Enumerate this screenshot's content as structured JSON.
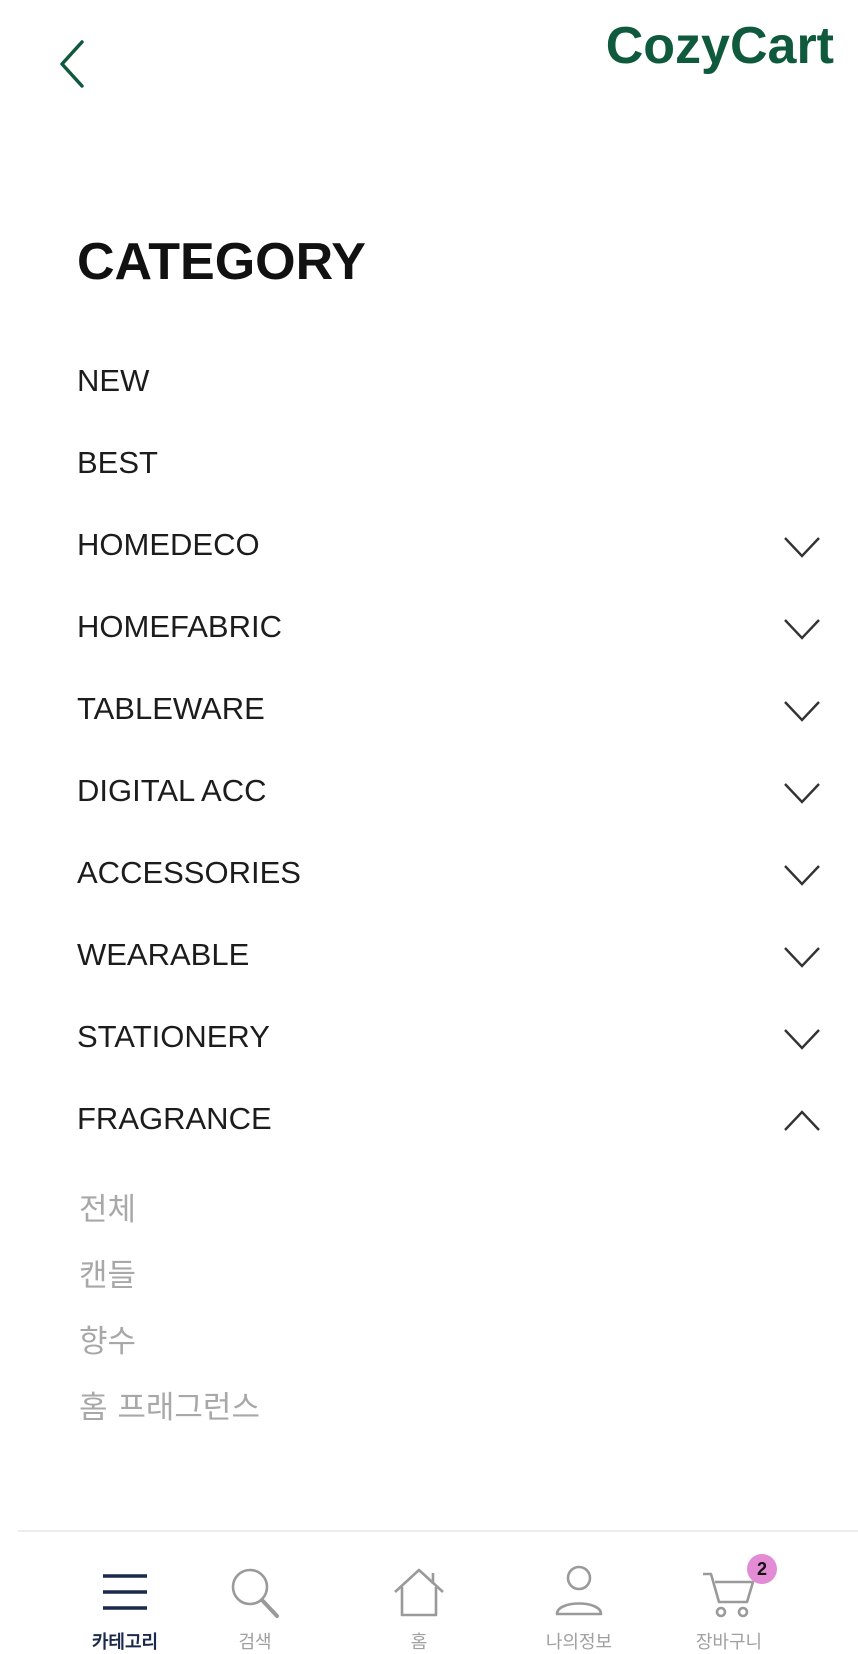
{
  "header": {
    "brand": "CozyCart",
    "brand_color": "#0f5a3c",
    "back_icon": "chevron-left-icon"
  },
  "page": {
    "title": "CATEGORY"
  },
  "categories": [
    {
      "label": "NEW",
      "expandable": false
    },
    {
      "label": "BEST",
      "expandable": false
    },
    {
      "label": "HOMEDECO",
      "expandable": true,
      "expanded": false
    },
    {
      "label": "HOMEFABRIC",
      "expandable": true,
      "expanded": false
    },
    {
      "label": "TABLEWARE",
      "expandable": true,
      "expanded": false
    },
    {
      "label": "DIGITAL ACC",
      "expandable": true,
      "expanded": false
    },
    {
      "label": "ACCESSORIES",
      "expandable": true,
      "expanded": false
    },
    {
      "label": "WEARABLE",
      "expandable": true,
      "expanded": false
    },
    {
      "label": "STATIONERY",
      "expandable": true,
      "expanded": false
    },
    {
      "label": "FRAGRANCE",
      "expandable": true,
      "expanded": true
    }
  ],
  "fragrance_subcategories": [
    "전체",
    "캔들",
    "향수",
    "홈 프래그런스"
  ],
  "tabbar": {
    "items": [
      {
        "label": "카테고리",
        "icon": "menu-icon",
        "active": true
      },
      {
        "label": "검색",
        "icon": "search-icon",
        "active": false
      },
      {
        "label": "홈",
        "icon": "home-icon",
        "active": false
      },
      {
        "label": "나의정보",
        "icon": "user-icon",
        "active": false
      },
      {
        "label": "장바구니",
        "icon": "cart-icon",
        "active": false
      }
    ],
    "cart_badge": "2",
    "badge_color": "#e48bd6",
    "active_color": "#1b2a4a",
    "inactive_color": "#a0a0a0"
  }
}
